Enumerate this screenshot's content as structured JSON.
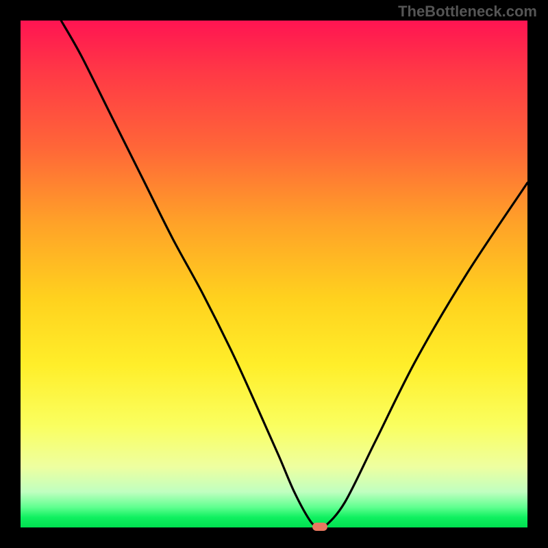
{
  "watermark": "TheBottleneck.com",
  "chart_data": {
    "type": "line",
    "title": "",
    "xlabel": "",
    "ylabel": "",
    "xlim": [
      0,
      100
    ],
    "ylim": [
      0,
      100
    ],
    "background_gradient": {
      "top": "#ff1452",
      "bottom": "#00e050",
      "meaning": "red = high bottleneck, green = low bottleneck"
    },
    "series": [
      {
        "name": "bottleneck-curve",
        "color": "#000000",
        "x": [
          8,
          12,
          18,
          24,
          30,
          36,
          42,
          47,
          51,
          54,
          57,
          58.5,
          60,
          64,
          70,
          78,
          88,
          100
        ],
        "y": [
          100,
          93,
          81,
          69,
          57,
          46,
          34,
          23,
          14,
          7,
          1.5,
          0.2,
          0.2,
          5,
          17,
          33,
          50,
          68
        ]
      }
    ],
    "marker": {
      "name": "optimal-point",
      "x": 59,
      "y": 0.2,
      "color": "#e87860"
    }
  }
}
